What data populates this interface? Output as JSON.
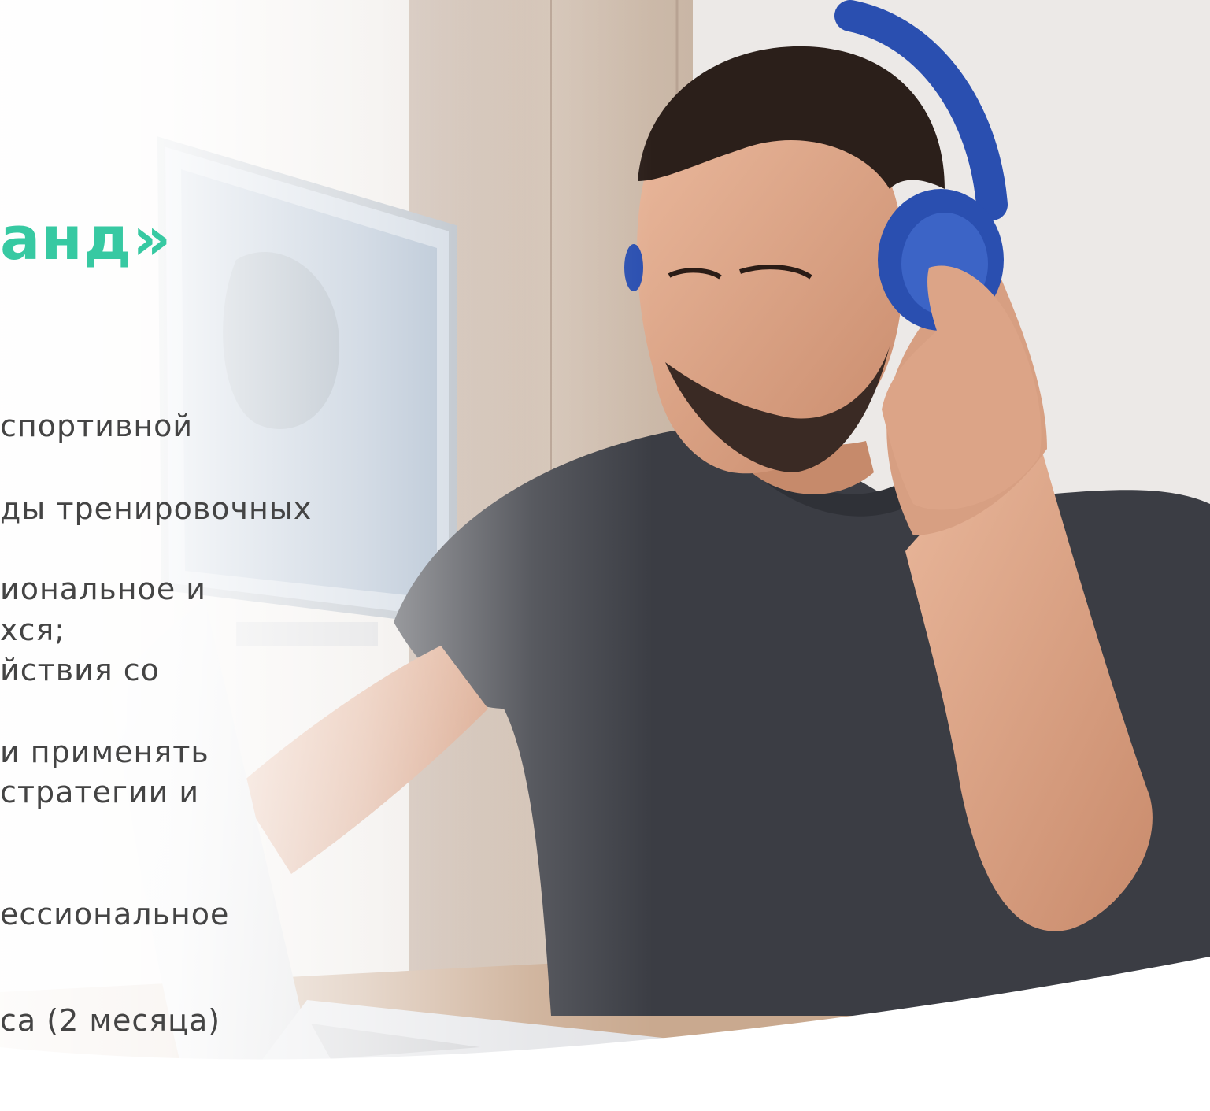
{
  "slide": {
    "title": "анд»",
    "lines": [
      "спортивной",
      "ды тренировочных",
      "иональное и",
      "хся;",
      "йствия со",
      "и применять",
      "стратегии и",
      "ессиональное",
      "са (2 месяца)"
    ]
  },
  "colors": {
    "accent": "#37c9a2",
    "body_text": "#444444",
    "headphones": "#2a4fb0",
    "tshirt": "#3b3d44"
  },
  "icons": {
    "person": "person-with-headphones-photo",
    "laptop": "laptop-icon",
    "monitor": "monitor-icon"
  }
}
